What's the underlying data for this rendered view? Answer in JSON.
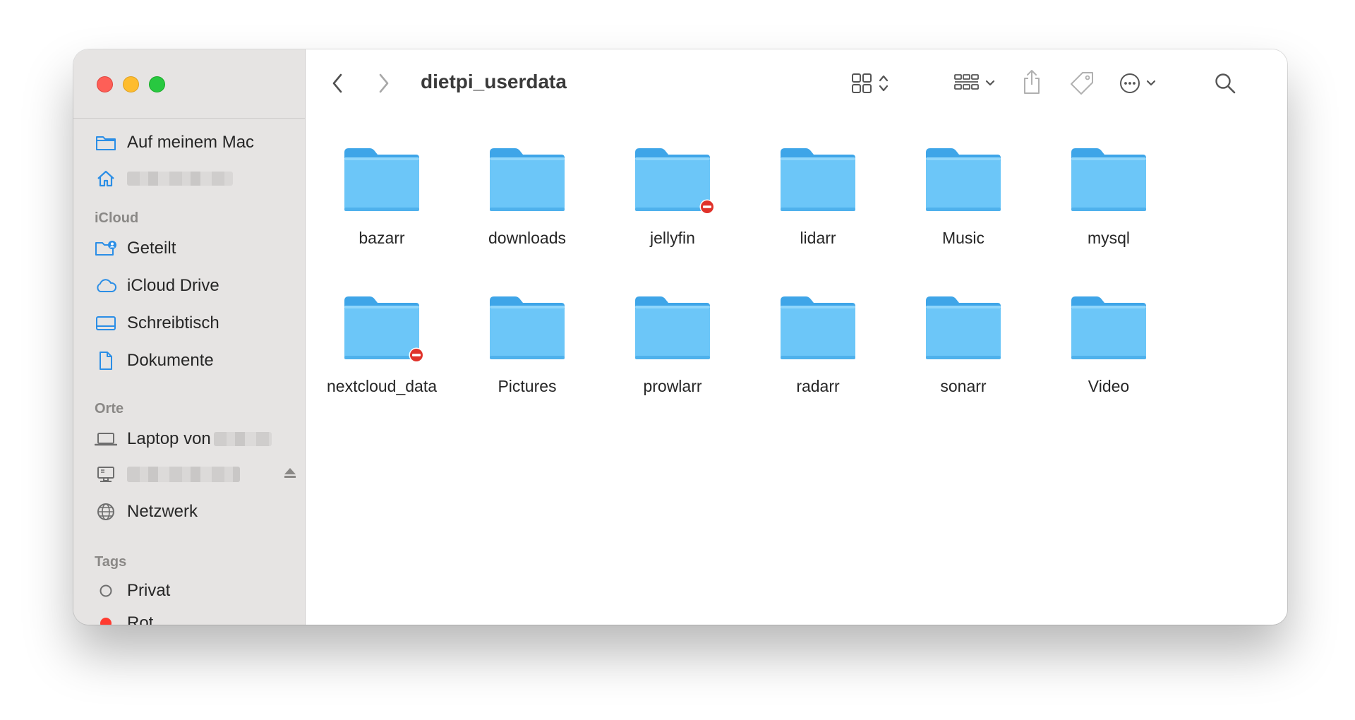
{
  "window": {
    "title": "dietpi_userdata"
  },
  "sidebar": {
    "favorites": [
      {
        "label": "Auf meinem Mac",
        "icon": "folder-icon"
      },
      {
        "label": "",
        "icon": "home-icon"
      }
    ],
    "icloud_header": "iCloud",
    "icloud": [
      {
        "label": "Geteilt",
        "icon": "shared-folder-icon"
      },
      {
        "label": "iCloud Drive",
        "icon": "cloud-icon"
      },
      {
        "label": "Schreibtisch",
        "icon": "desktop-icon"
      },
      {
        "label": "Dokumente",
        "icon": "document-icon"
      }
    ],
    "locations_header": "Orte",
    "locations": [
      {
        "label": "Laptop von",
        "icon": "laptop-icon"
      },
      {
        "label": "",
        "icon": "server-icon"
      },
      {
        "label": "Netzwerk",
        "icon": "network-icon"
      }
    ],
    "tags_header": "Tags",
    "tags": [
      {
        "label": "Privat",
        "icon": "tag-circle-icon"
      },
      {
        "label": "Rot",
        "icon": "tag-red-icon",
        "color": "#ff3b30"
      }
    ]
  },
  "folders": [
    {
      "name": "bazarr",
      "restricted": false
    },
    {
      "name": "downloads",
      "restricted": false
    },
    {
      "name": "jellyfin",
      "restricted": true
    },
    {
      "name": "lidarr",
      "restricted": false
    },
    {
      "name": "Music",
      "restricted": false
    },
    {
      "name": "mysql",
      "restricted": false
    },
    {
      "name": "nextcloud_data",
      "restricted": true
    },
    {
      "name": "Pictures",
      "restricted": false
    },
    {
      "name": "prowlarr",
      "restricted": false
    },
    {
      "name": "radarr",
      "restricted": false
    },
    {
      "name": "sonarr",
      "restricted": false
    },
    {
      "name": "Video",
      "restricted": false
    }
  ],
  "colors": {
    "accent": "#2b8ee6",
    "folder_front": "#6cc6f8",
    "folder_back": "#3ea5e8",
    "restricted_badge": "#e0322a"
  }
}
